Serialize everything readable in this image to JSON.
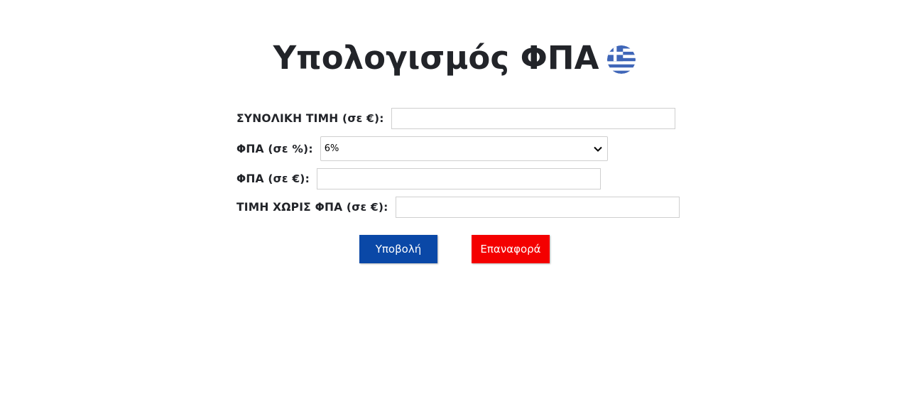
{
  "header": {
    "title": "Υπολογισμός ΦΠΑ",
    "flag_icon": "greek-flag-icon"
  },
  "form": {
    "total_price_label": "ΣΥΝΟΛΙΚΗ ΤΙΜΗ (σε €):",
    "total_price_value": "",
    "vat_percent_label": "ΦΠΑ (σε %):",
    "vat_percent_selected": "6%",
    "vat_amount_label": "ΦΠΑ (σε €):",
    "vat_amount_value": "",
    "price_without_vat_label": "ΤΙΜΗ ΧΩΡΙΣ ΦΠΑ (σε €):",
    "price_without_vat_value": ""
  },
  "buttons": {
    "submit_label": "Υποβολή",
    "reset_label": "Επαναφορά"
  },
  "colors": {
    "submit_bg": "#0a48a7",
    "reset_bg": "#f40000",
    "flag_blue": "#3f66b8",
    "text": "#222429"
  }
}
